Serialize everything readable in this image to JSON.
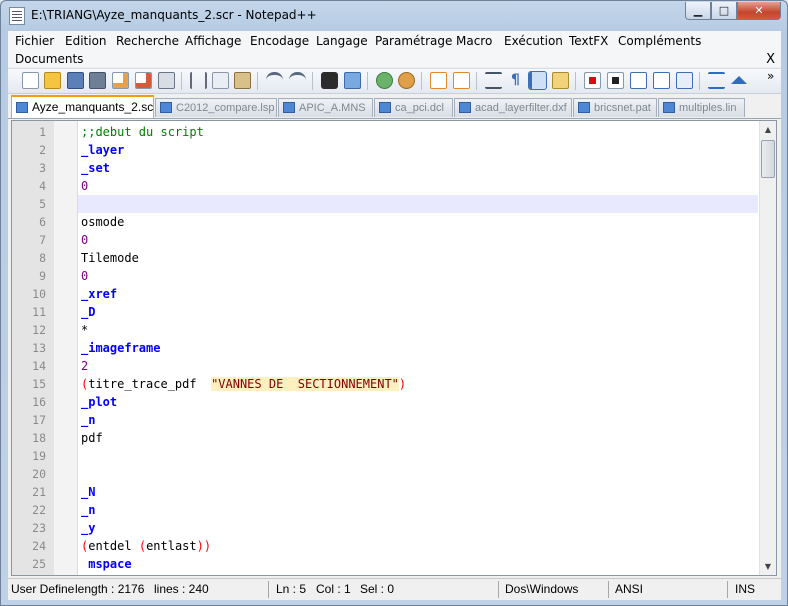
{
  "window": {
    "title": "E:\\TRIANG\\Ayze_manquants_2.scr - Notepad++",
    "minimize": "▁",
    "maximize": "□",
    "close": "✕"
  },
  "menu": {
    "items": [
      "Fichier",
      "Edition",
      "Recherche",
      "Affichage",
      "Encodage",
      "Langage",
      "Paramétrage",
      "Macro",
      "Exécution",
      "TextFX",
      "Compléments",
      "Documents"
    ],
    "close": "X"
  },
  "toolbar": {
    "icons": [
      "new-file",
      "open-file",
      "save",
      "save-all",
      "close",
      "close-all",
      "print",
      "cut",
      "copy",
      "paste",
      "undo",
      "redo",
      "find",
      "replace",
      "zoom-in",
      "zoom-out",
      "sync-v",
      "sync-h",
      "wrap",
      "show-all",
      "indent-guide",
      "udl-panel",
      "record-macro",
      "stop-macro",
      "play-macro",
      "run-macro-multiple",
      "save-macro",
      "trim",
      "up-arrow"
    ],
    "overflow": "»"
  },
  "tabs": [
    {
      "label": "Ayze_manquants_2.scr",
      "active": true
    },
    {
      "label": "C2012_compare.lsp",
      "active": false
    },
    {
      "label": "APIC_A.MNS",
      "active": false
    },
    {
      "label": "ca_pci.dcl",
      "active": false
    },
    {
      "label": "acad_layerfilter.dxf",
      "active": false
    },
    {
      "label": "bricsnet.pat",
      "active": false
    },
    {
      "label": "multiples.lin",
      "active": false
    }
  ],
  "editor": {
    "current_line": 5,
    "lines": [
      {
        "n": "1",
        "text": ";;debut du script",
        "type": "comment"
      },
      {
        "n": "2",
        "text": "_layer",
        "type": "kw"
      },
      {
        "n": "3",
        "text": "_set",
        "type": "kw"
      },
      {
        "n": "4",
        "text": "0",
        "type": "num"
      },
      {
        "n": "5",
        "text": "",
        "type": "plain"
      },
      {
        "n": "6",
        "text": "osmode",
        "type": "plain"
      },
      {
        "n": "7",
        "text": "0",
        "type": "num"
      },
      {
        "n": "8",
        "text": "Tilemode",
        "type": "plain"
      },
      {
        "n": "9",
        "text": "0",
        "type": "num"
      },
      {
        "n": "10",
        "text": "_xref",
        "type": "kw"
      },
      {
        "n": "11",
        "text": "_D",
        "type": "kw"
      },
      {
        "n": "12",
        "text": "*",
        "type": "plain"
      },
      {
        "n": "13",
        "text": "_imageframe",
        "type": "kw"
      },
      {
        "n": "14",
        "text": "2",
        "type": "num"
      },
      {
        "n": "15",
        "text": "(titre_trace_pdf  \"VANNES DE  SECTIONNEMENT\")",
        "type": "str"
      },
      {
        "n": "16",
        "text": "_plot",
        "type": "kw"
      },
      {
        "n": "17",
        "text": "_n",
        "type": "kw"
      },
      {
        "n": "18",
        "text": "pdf",
        "type": "plain"
      },
      {
        "n": "19",
        "text": "",
        "type": "plain"
      },
      {
        "n": "20",
        "text": "",
        "type": "plain"
      },
      {
        "n": "21",
        "text": "_N",
        "type": "kw"
      },
      {
        "n": "22",
        "text": "_n",
        "type": "kw"
      },
      {
        "n": "23",
        "text": "_y",
        "type": "kw"
      },
      {
        "n": "24",
        "text": "(entdel (entlast))",
        "type": "paren"
      },
      {
        "n": "25",
        "text": " mspace",
        "type": "kw"
      }
    ]
  },
  "status": {
    "lang": "User Define",
    "length": "length : 2176",
    "lines": "lines : 240",
    "ln": "Ln : 5",
    "col": "Col : 1",
    "sel": "Sel : 0",
    "eol": "Dos\\Windows",
    "encoding": "ANSI",
    "mode": "INS"
  },
  "colors": {
    "comment": "#008000",
    "keyword": "#0000ff",
    "number": "#800080",
    "string": "#800000",
    "tab_accent": "#f39c12"
  }
}
